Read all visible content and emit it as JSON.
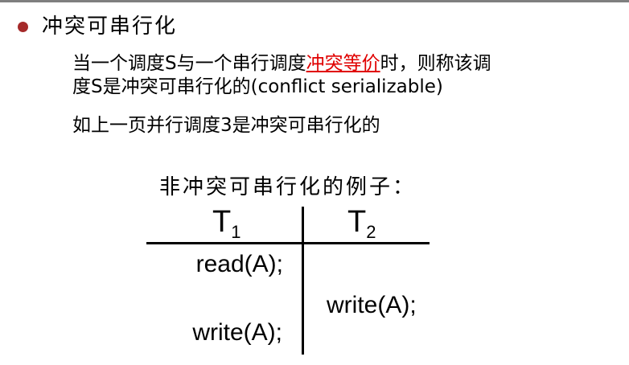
{
  "heading": "冲突可串行化",
  "paragraph1": {
    "line1_before": "当一个调度S与一个串行调度",
    "line1_highlight": "冲突等价",
    "line1_after": "时，则称该调",
    "line2": "度S是冲突可串行化的(conflict serializable)"
  },
  "paragraph2": "如上一页并行调度3是冲突可串行化的",
  "example": {
    "title": "非冲突可串行化的例子：",
    "t1_label": "T",
    "t1_sub": "1",
    "t2_label": "T",
    "t2_sub": "2",
    "op1": "read(A);",
    "op2": "write(A);",
    "op3": "write(A);"
  },
  "colors": {
    "bullet": "#a52a2a",
    "highlight": "#e00000",
    "top_rule": "#7f7f7f"
  }
}
